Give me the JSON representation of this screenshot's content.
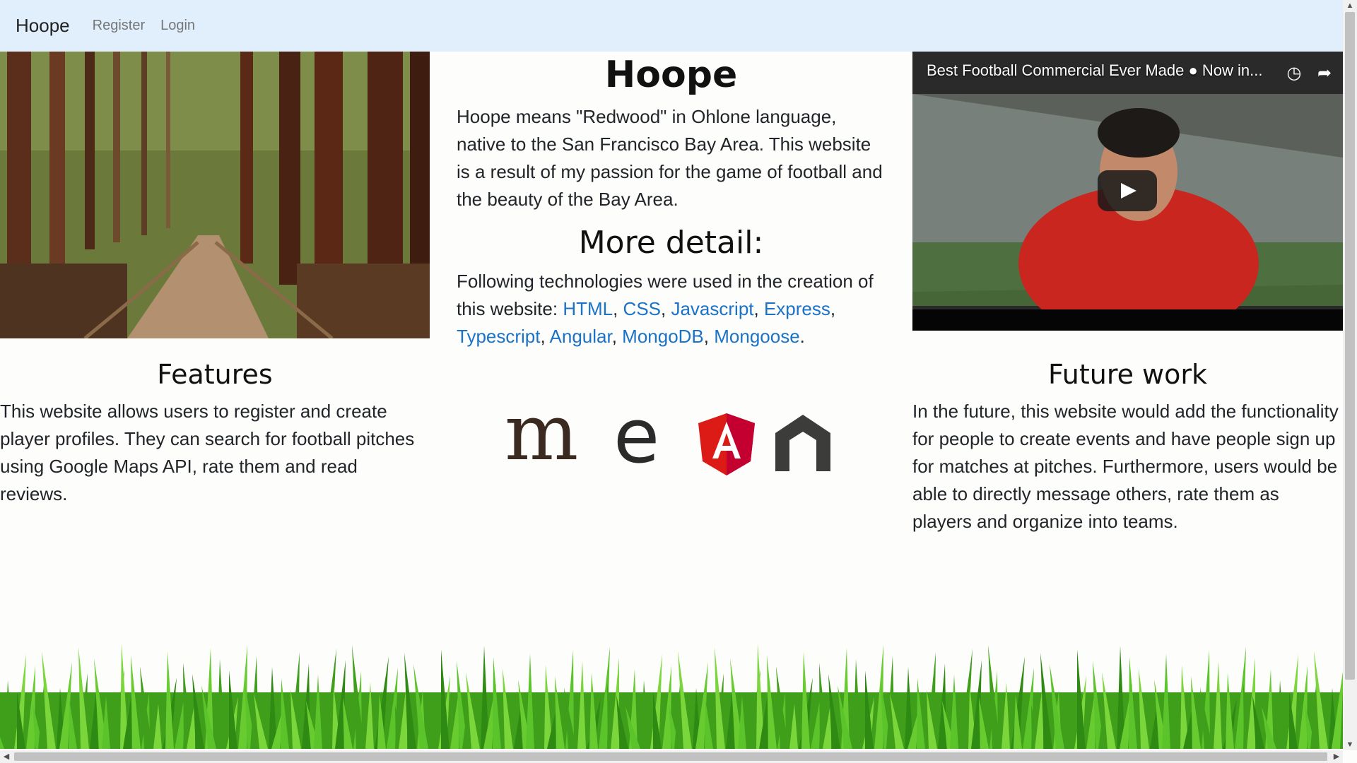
{
  "navbar": {
    "brand": "Hoope",
    "links": [
      "Register",
      "Login"
    ]
  },
  "main": {
    "title": "Hoope",
    "intro": "Hoope means \"Redwood\" in Ohlone language, native to the San Francisco Bay Area. This website is a result of my passion for the game of football and the beauty of the Bay Area.",
    "detail_heading": "More detail:",
    "detail_text": "Following technologies were used in the creation of this website:",
    "technologies": [
      "HTML",
      "CSS",
      "Javascript",
      "Express",
      "Typescript",
      "Angular",
      "MongoDB",
      "Mongoose"
    ]
  },
  "features": {
    "heading": "Features",
    "text": "This website allows users to register and create player profiles. They can search for football pitches using Google Maps API, rate them and read reviews."
  },
  "future": {
    "heading": "Future work",
    "text": "In the future, this website would add the functionality for people to create events and have people sign up for matches at pitches. Furthermore, users would be able to directly message others, rate them as players and organize into teams."
  },
  "video": {
    "title": "Best Football Commercial Ever Made ● Now in..."
  },
  "logo": {
    "m": "m",
    "e": "e",
    "a": "A"
  },
  "colors": {
    "nav_bg": "#e1eefc",
    "link": "#1a73c7",
    "angular": "#dd1b16",
    "grass": "#4caf1d"
  },
  "icons": {
    "clock": "clock-icon",
    "share": "share-icon",
    "play": "play-icon"
  }
}
